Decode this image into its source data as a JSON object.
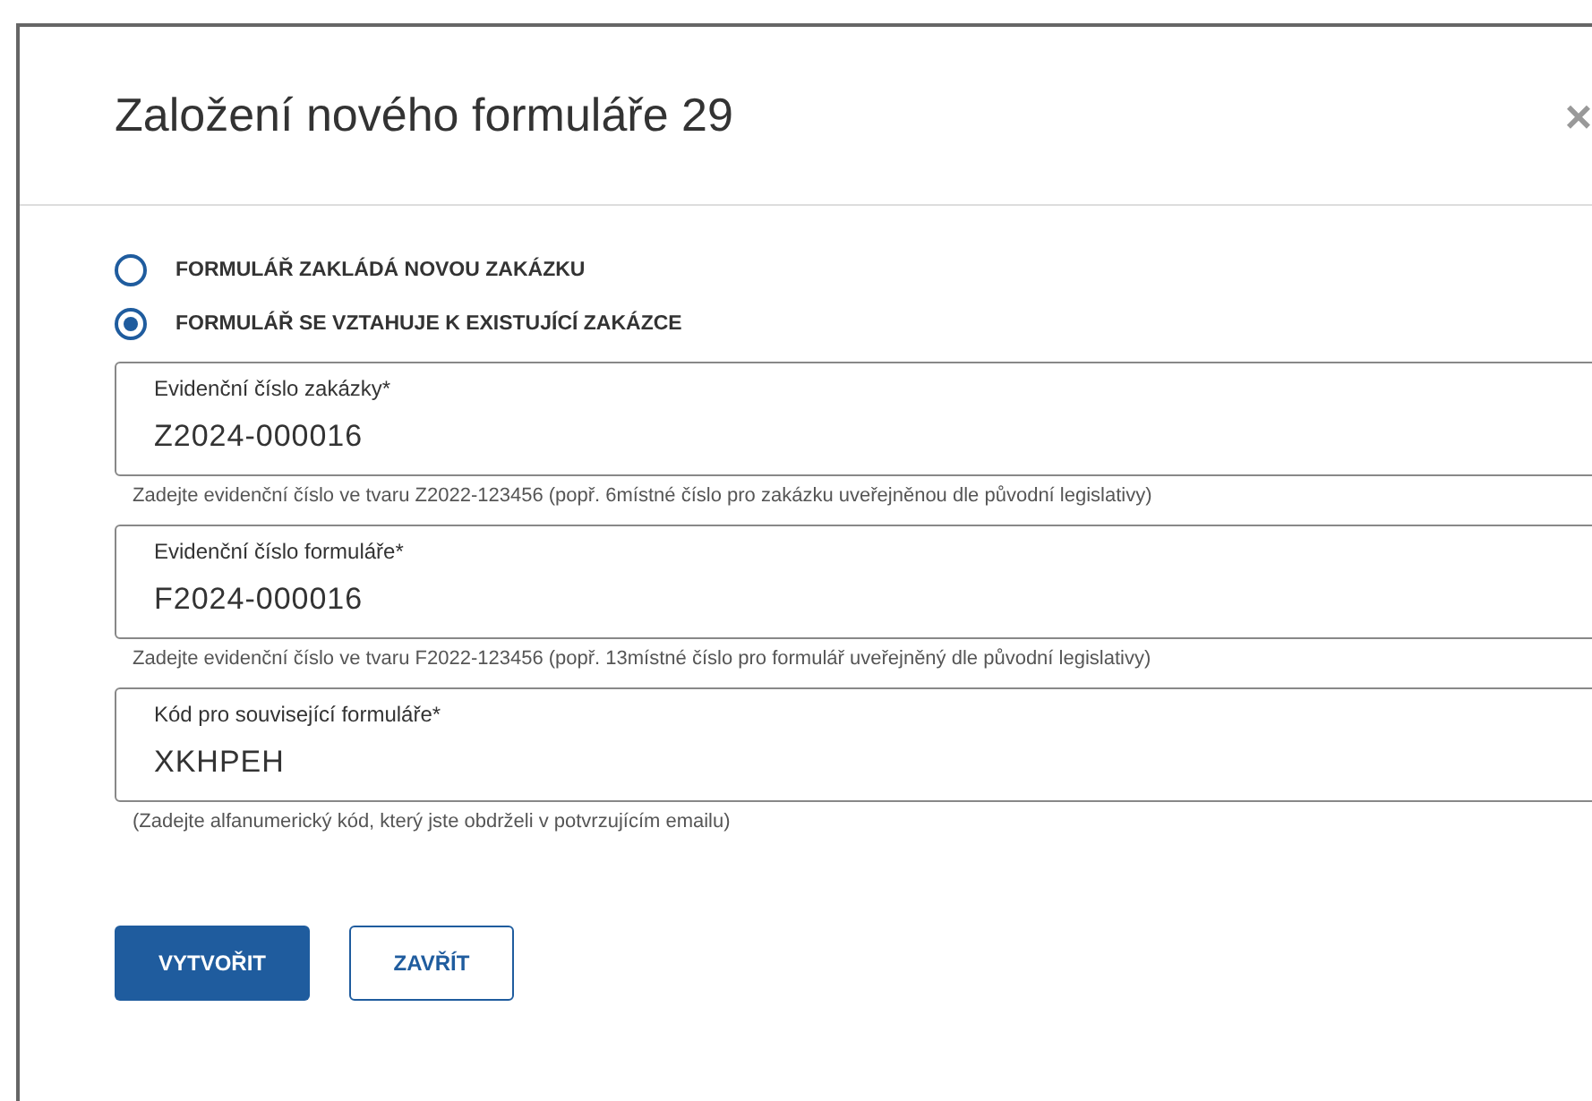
{
  "dialog": {
    "title": "Založení nového formuláře 29",
    "close": "×"
  },
  "options": [
    {
      "label": "FORMULÁŘ ZAKLÁDÁ NOVOU ZAKÁZKU",
      "selected": false
    },
    {
      "label": "FORMULÁŘ SE VZTAHUJE K EXISTUJÍCÍ ZAKÁZCE",
      "selected": true
    }
  ],
  "fields": [
    {
      "label": "Evidenční číslo zakázky*",
      "value": "Z2024-000016",
      "hint": "Zadejte evidenční číslo ve tvaru Z2022-123456 (popř. 6místné číslo pro zakázku uveřejněnou dle původní legislativy)"
    },
    {
      "label": "Evidenční číslo formuláře*",
      "value": "F2024-000016",
      "hint": "Zadejte evidenční číslo ve tvaru F2022-123456 (popř. 13místné číslo pro formulář uveřejněný dle původní legislativy)"
    },
    {
      "label": "Kód pro související formuláře*",
      "value": "XKHPEH",
      "hint": "(Zadejte alfanumerický kód, který jste obdrželi v potvrzujícím emailu)"
    }
  ],
  "buttons": [
    {
      "label": "VYTVOŘIT",
      "kind": "primary"
    },
    {
      "label": "ZAVŘÍT",
      "kind": "secondary"
    }
  ]
}
